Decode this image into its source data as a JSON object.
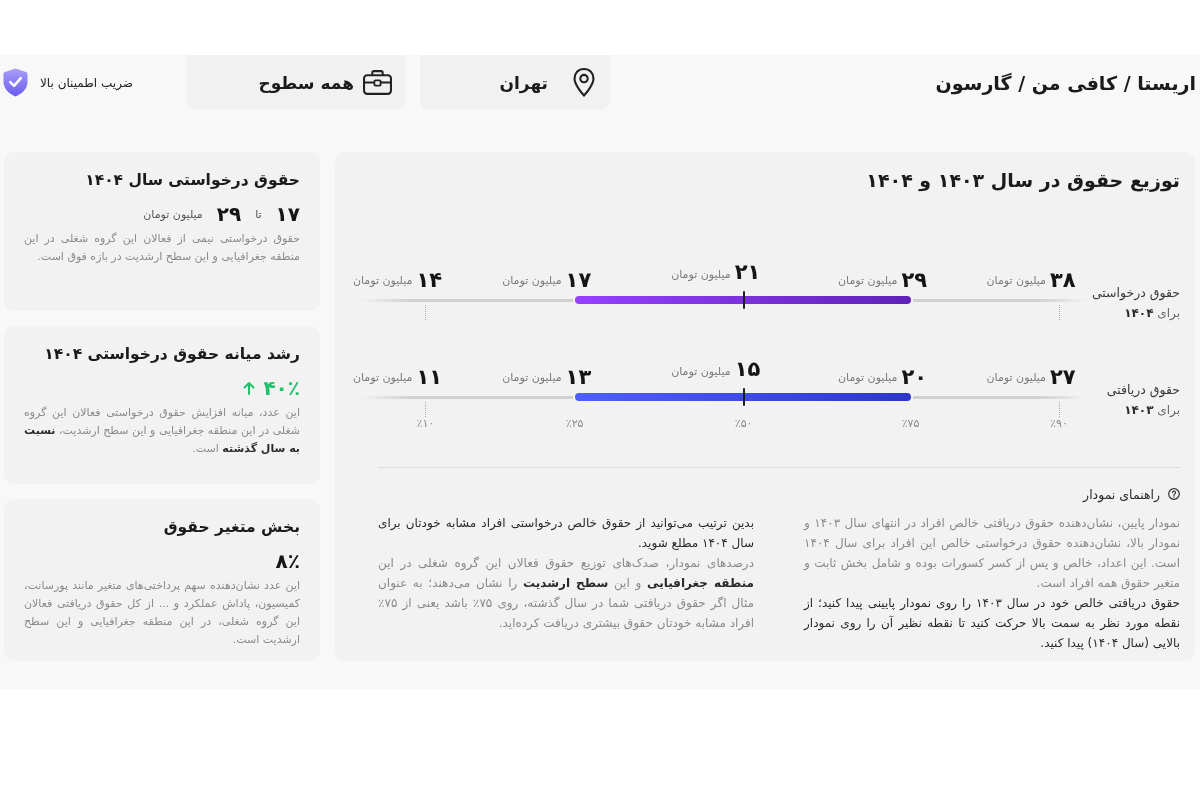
{
  "header": {
    "breadcrumb": "اریستا / کافی من / گارسون",
    "location": "تهران",
    "level": "همه سطوح",
    "confidence": "ضریب اطمینان بالا"
  },
  "salary_distribution": {
    "title": "توزیع حقوق در سال ۱۴۰۳ و ۱۴۰۴",
    "rows": [
      {
        "label": "حقوق درخواستی",
        "sublabel": "برای **۱۴۰۴**",
        "color": "#5e22b8",
        "values": [
          {
            "amount": "۳۸",
            "unit": "میلیون تومان"
          },
          {
            "amount": "۲۹",
            "unit": "میلیون تومان"
          },
          {
            "amount": "۲۱",
            "unit": "میلیون تومان"
          },
          {
            "amount": "۱۷",
            "unit": "میلیون تومان"
          },
          {
            "amount": "۱۴",
            "unit": "میلیون تومان"
          }
        ]
      },
      {
        "label": "حقوق دریافتی",
        "sublabel": "برای **۱۴۰۳**",
        "color": "#2c37c9",
        "values": [
          {
            "amount": "۲۷",
            "unit": "میلیون تومان"
          },
          {
            "amount": "۲۰",
            "unit": "میلیون تومان"
          },
          {
            "amount": "۱۵",
            "unit": "میلیون تومان"
          },
          {
            "amount": "۱۳",
            "unit": "میلیون تومان"
          },
          {
            "amount": "۱۱",
            "unit": "میلیون تومان"
          }
        ]
      }
    ],
    "percentiles": [
      "٪۹۰",
      "٪۷۵",
      "٪۵۰",
      "٪۲۵",
      "٪۱۰"
    ]
  },
  "legend": {
    "title": "راهنمای نمودار",
    "columns": [
      [
        {
          "text": "نمودار پایین، نشان‌دهنده حقوق دریافتی خالص افراد در انتهای سال ۱۴۰۳ و نمودار بالا، نشان‌دهنده حقوق درخواستی خالص این افراد برای سال ۱۴۰۴ است. این اعداد، خالص و پس از کسر کسورات بوده و شامل بخش ثابت و متغیر حقوق همه افراد است.",
          "emphasis": false
        },
        {
          "text": "حقوق دریافتی خالص خود در سال ۱۴۰۳ را روی نمودار پایینی پیدا کنید؛ از نقطه مورد نظر به سمت بالا حرکت کنید تا نقطه نظیر آن را روی نمودار بالایی (سال ۱۴۰۴) پیدا کنید.",
          "emphasis": true
        }
      ],
      [
        {
          "text": "بدین ترتیب می‌توانید از حقوق خالص درخواستی افراد مشابه خودتان برای سال ۱۴۰۴ مطلع شوید.",
          "emphasis": true
        },
        {
          "text": "درصدهای نمودار، صدک‌های توزیع حقوق فعالان این گروه شغلی در این **منطقه جغرافیایی** و این **سطح ارشدیت** را نشان می‌دهند؛ به عنوان مثال اگر حقوق دریافتی شما در سال گذشته، روی ۷۵٪ باشد یعنی از ۷۵٪ افراد مشابه خودتان حقوق بیشتری دریافت کرده‌اید.",
          "emphasis": false
        }
      ]
    ]
  },
  "summary_cards": [
    {
      "kind": "range",
      "title": "حقوق درخواستی سال ۱۴۰۴",
      "from": "۱۷",
      "separator": "تا",
      "to": "۲۹",
      "unit": "میلیون تومان",
      "description": "حقوق درخواستی نیمی از فعالان این گروه شغلی در این منطقه جغرافیایی و این سطح ارشدیت در بازه فوق است."
    },
    {
      "kind": "growth",
      "title": "رشد میانه حقوق درخواستی ۱۴۰۴",
      "value": "۴۰٪",
      "description": "این عدد، میانه افزایش حقوق درخواستی فعالان این گروه شغلی در این منطقه جغرافیایی و این سطح ارشدیت، **نسبت به سال گذشته** است."
    },
    {
      "kind": "share",
      "title": "بخش متغیر حقوق",
      "value": "۸٪",
      "description": "این عدد نشان‌دهنده سهم پرداختی‌های متغیر مانند پورسانت، کمیسیون، پاداش عملکرد و ... از کل حقوق دریافتی فعالان این گروه شغلی، در این منطقه جغرافیایی و این سطح ارشدیت است."
    }
  ]
}
